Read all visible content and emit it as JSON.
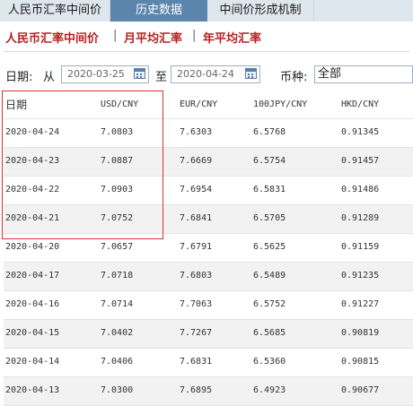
{
  "tabs": [
    {
      "label": "人民币汇率中间价",
      "active": false
    },
    {
      "label": "历史数据",
      "active": true
    },
    {
      "label": "中间价形成机制",
      "active": false
    }
  ],
  "subnav": {
    "item1": "人民币汇率中间价",
    "sep": "|",
    "item2": "月平均汇率",
    "item3": "年平均汇率"
  },
  "filter": {
    "date_label": "日期:",
    "from_label": "从",
    "from_value": "2020-03-25",
    "to_label": "至",
    "to_value": "2020-04-24",
    "currency_label": "币种:",
    "currency_value": "全部"
  },
  "table": {
    "headers": [
      "日期",
      "USD/CNY",
      "EUR/CNY",
      "100JPY/CNY",
      "HKD/CNY"
    ],
    "rows": [
      [
        "2020-04-24",
        "7.0803",
        "7.6303",
        "6.5768",
        "0.91345"
      ],
      [
        "2020-04-23",
        "7.0887",
        "7.6669",
        "6.5754",
        "0.91457"
      ],
      [
        "2020-04-22",
        "7.0903",
        "7.6954",
        "6.5831",
        "0.91486"
      ],
      [
        "2020-04-21",
        "7.0752",
        "7.6841",
        "6.5705",
        "0.91289"
      ],
      [
        "2020-04-20",
        "7.0657",
        "7.6791",
        "6.5625",
        "0.91159"
      ],
      [
        "2020-04-17",
        "7.0718",
        "7.6803",
        "6.5489",
        "0.91235"
      ],
      [
        "2020-04-16",
        "7.0714",
        "7.7063",
        "6.5752",
        "0.91227"
      ],
      [
        "2020-04-15",
        "7.0402",
        "7.7267",
        "6.5685",
        "0.90819"
      ],
      [
        "2020-04-14",
        "7.0406",
        "7.6831",
        "6.5360",
        "0.90815"
      ],
      [
        "2020-04-13",
        "7.0300",
        "7.6895",
        "6.4923",
        "0.90677"
      ]
    ]
  },
  "colors": {
    "tab_bg": "#dfe7ee",
    "tab_active": "#5b85ad",
    "subnav_text": "#b72121",
    "highlight_border": "#d93030"
  }
}
